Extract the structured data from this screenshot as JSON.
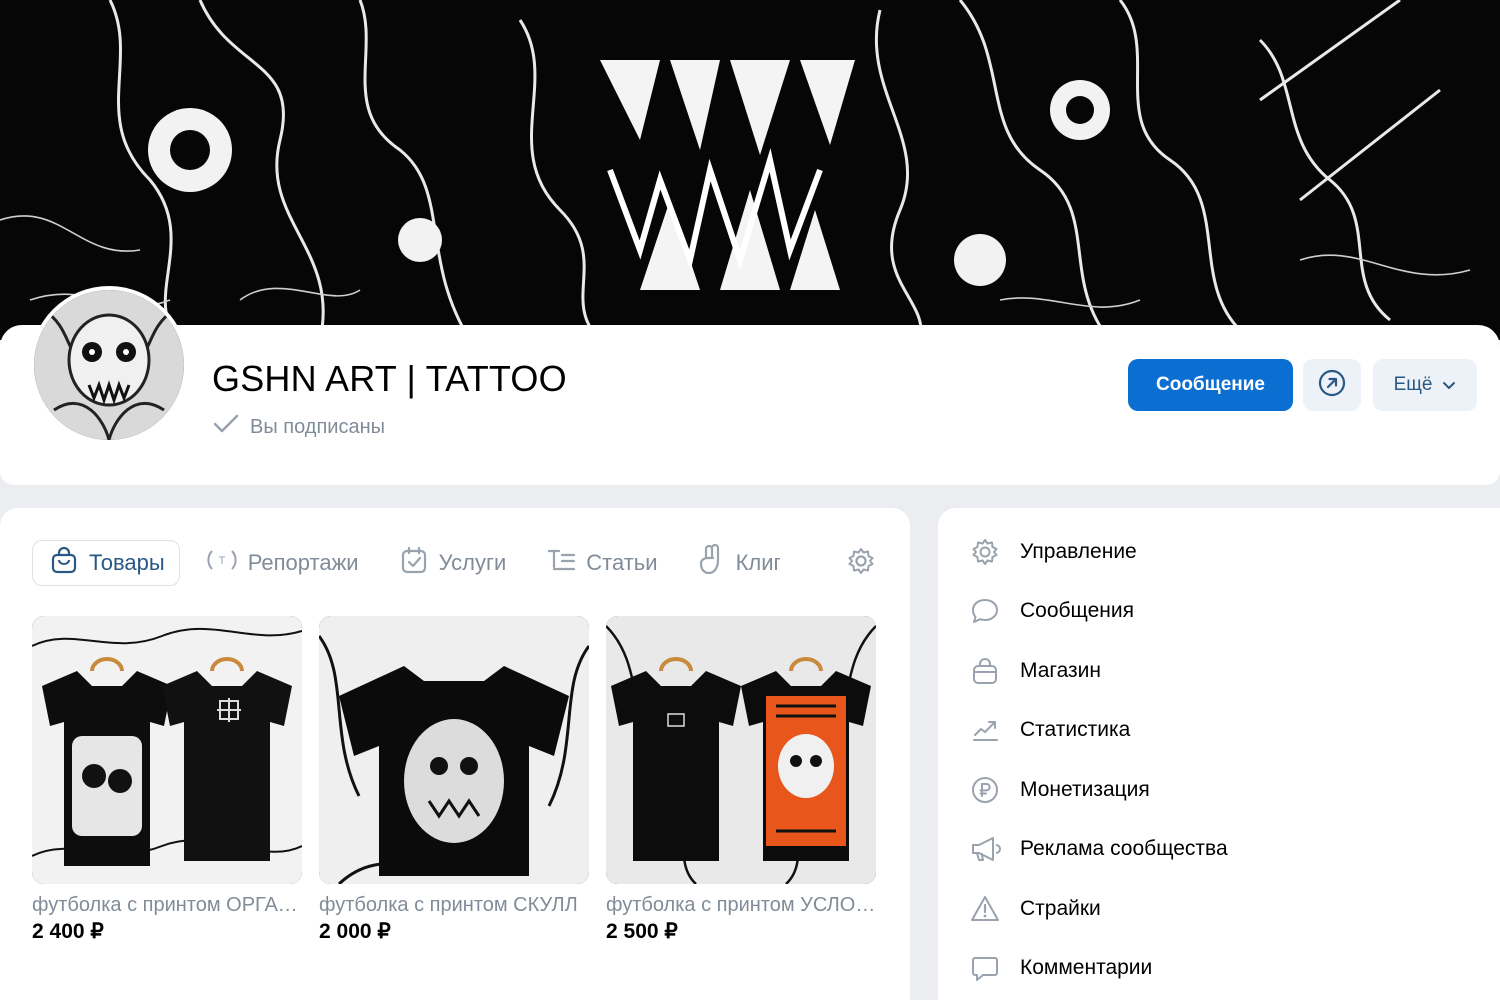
{
  "group": {
    "name": "GSHN ART | TATTOO",
    "subscribed_label": "Вы подписаны"
  },
  "actions": {
    "message_label": "Сообщение",
    "more_label": "Ещё"
  },
  "tabs": [
    {
      "label": "Товары",
      "icon": "bag-icon"
    },
    {
      "label": "Репортажи",
      "icon": "live-icon"
    },
    {
      "label": "Услуги",
      "icon": "calendar-check-icon"
    },
    {
      "label": "Статьи",
      "icon": "text-icon"
    },
    {
      "label": "Клипы",
      "icon": "clips-icon"
    }
  ],
  "products": [
    {
      "title": "футболка с принтом ОРГАЗМ НЕНАВИСТИ",
      "price": "2 400 ₽"
    },
    {
      "title": "футболка с принтом СКУЛЛ",
      "price": "2 000 ₽"
    },
    {
      "title": "футболка с принтом УСЛОВИЯ",
      "price": "2 500 ₽"
    }
  ],
  "menu": [
    {
      "label": "Управление",
      "icon": "gear-icon"
    },
    {
      "label": "Сообщения",
      "icon": "message-icon"
    },
    {
      "label": "Магазин",
      "icon": "bag-icon"
    },
    {
      "label": "Статистика",
      "icon": "stats-icon"
    },
    {
      "label": "Монетизация",
      "icon": "ruble-icon"
    },
    {
      "label": "Реклама сообщества",
      "icon": "megaphone-icon"
    },
    {
      "label": "Страйки",
      "icon": "warning-icon"
    },
    {
      "label": "Комментарии",
      "icon": "comment-icon"
    }
  ],
  "colors": {
    "primary": "#0a6fd1",
    "link": "#2a5885",
    "secondary_text": "#818c99",
    "page_bg": "#ebedf0",
    "accent_orange": "#e8561c"
  }
}
